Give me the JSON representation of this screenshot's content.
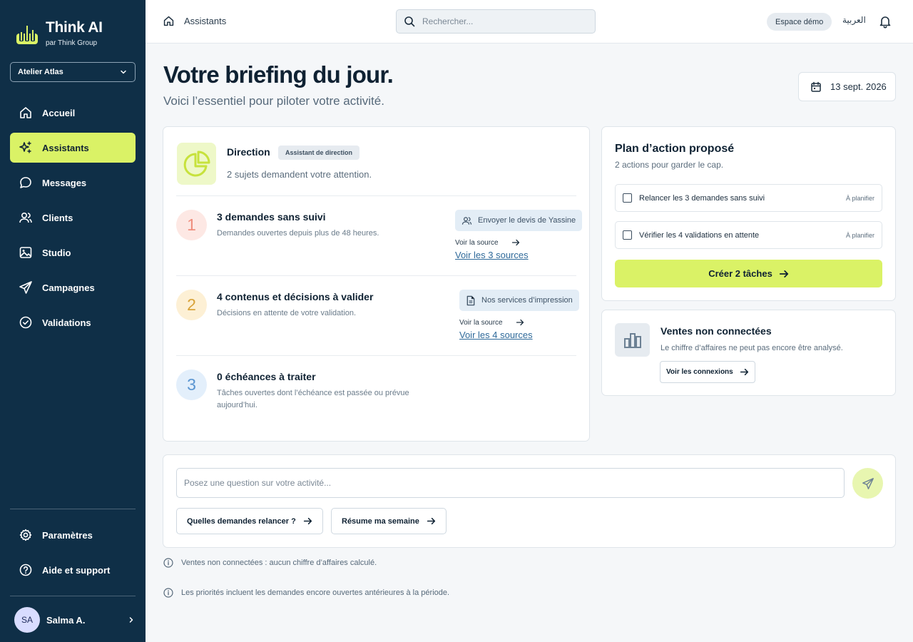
{
  "app": {
    "name": "Think AI",
    "tagline": "par Think Group",
    "workspace": "Atelier Atlas"
  },
  "sidebar": {
    "items": [
      {
        "label": "Accueil",
        "icon": "home-icon"
      },
      {
        "label": "Assistants",
        "icon": "sparkles-icon",
        "active": true
      },
      {
        "label": "Messages",
        "icon": "chat-bubble-icon"
      },
      {
        "label": "Clients",
        "icon": "users-icon"
      },
      {
        "label": "Studio",
        "icon": "image-icon"
      },
      {
        "label": "Campagnes",
        "icon": "send-icon"
      },
      {
        "label": "Validations",
        "icon": "check-circle-icon"
      }
    ],
    "bottom_items": [
      {
        "label": "Paramètres",
        "icon": "gear-icon"
      },
      {
        "label": "Aide et support",
        "icon": "help-circle-icon"
      }
    ],
    "user": {
      "initials": "SA",
      "name": "Salma A."
    }
  },
  "topbar": {
    "breadcrumb": "Assistants",
    "search_placeholder": "Rechercher...",
    "demo_badge": "Espace démo",
    "language": "العربية"
  },
  "header": {
    "title": "Votre briefing du jour.",
    "subtitle": "Voici l’essentiel pour piloter votre activité.",
    "date": "13 sept. 2026"
  },
  "direction": {
    "title": "Direction",
    "tag": "Assistant de direction",
    "subtitle": "2 sujets demandent votre attention.",
    "items": [
      {
        "number": "1",
        "title": "3 demandes sans suivi",
        "desc": "Demandes ouvertes depuis plus de 48 heures.",
        "chip": "Envoyer le devis de Yassine",
        "chip_icon": "users-icon",
        "source_label": "Voir la source",
        "all_sources": "Voir les 3 sources"
      },
      {
        "number": "2",
        "title": "4 contenus et décisions à valider",
        "desc": "Décisions en attente de votre validation.",
        "chip": "Nos services d’impression",
        "chip_icon": "document-icon",
        "source_label": "Voir la source",
        "all_sources": "Voir les 4 sources"
      },
      {
        "number": "3",
        "title": "0 échéances à traiter",
        "desc": "Tâches ouvertes dont l’échéance est passée ou prévue aujourd’hui."
      }
    ]
  },
  "plan": {
    "title": "Plan d’action proposé",
    "subtitle": "2 actions pour garder le cap.",
    "tasks": [
      {
        "label": "Relancer les 3 demandes sans suivi",
        "tag": "À planifier"
      },
      {
        "label": "Vérifier les 4 validations en attente",
        "tag": "À planifier"
      }
    ],
    "create_button": "Créer 2 tâches"
  },
  "sales": {
    "title": "Ventes non connectées",
    "subtitle": "Le chiffre d’affaires ne peut pas encore être analysé.",
    "button": "Voir les connexions"
  },
  "ask": {
    "placeholder": "Posez une question sur votre activité...",
    "suggestions": [
      "Quelles demandes relancer ?",
      "Résume ma semaine"
    ]
  },
  "notes": [
    "Ventes non connectées : aucun chiffre d’affaires calculé.",
    "Les priorités incluent les demandes encore ouvertes antérieures à la période."
  ],
  "colors": {
    "sidebar_bg": "#0f2f47",
    "accent": "#daf266",
    "link": "#2f6a9a"
  }
}
